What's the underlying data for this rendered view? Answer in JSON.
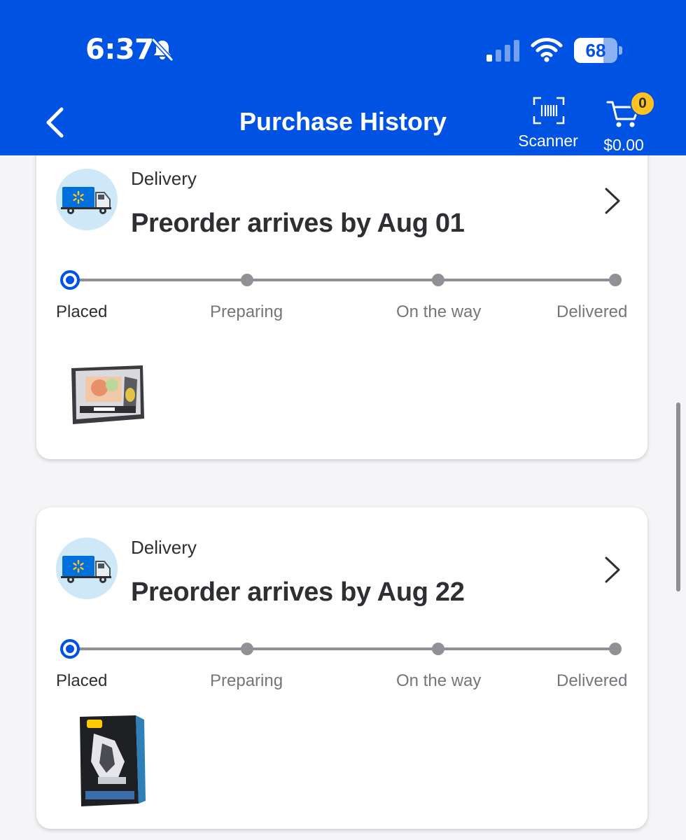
{
  "status_bar": {
    "time": "6:37",
    "battery": "68",
    "battery_level": 0.68,
    "icons": [
      "bell-slash-icon",
      "cellular-signal-icon",
      "wifi-icon",
      "battery-icon"
    ]
  },
  "header": {
    "title": "Purchase History",
    "back_icon": "chevron-left-icon",
    "scanner_label": "Scanner",
    "cart_count": "0",
    "cart_total": "$0.00",
    "background_color": "#0053e2",
    "badge_color": "#ffc220"
  },
  "orders": [
    {
      "type": "Delivery",
      "headline": "Preorder arrives by Aug 01",
      "steps": [
        "Placed",
        "Preparing",
        "On the way",
        "Delivered"
      ],
      "current_step": 0,
      "item_image": "pokemon-victini-box-image"
    },
    {
      "type": "Delivery",
      "headline": "Preorder arrives by Aug 22",
      "steps": [
        "Placed",
        "Preparing",
        "On the way",
        "Delivered"
      ],
      "current_step": 0,
      "item_image": "pokemon-black-bolt-box-image"
    }
  ],
  "colors": {
    "accent": "#0053e2",
    "track": "#909196",
    "truck_circle": "#cfe8f7"
  }
}
